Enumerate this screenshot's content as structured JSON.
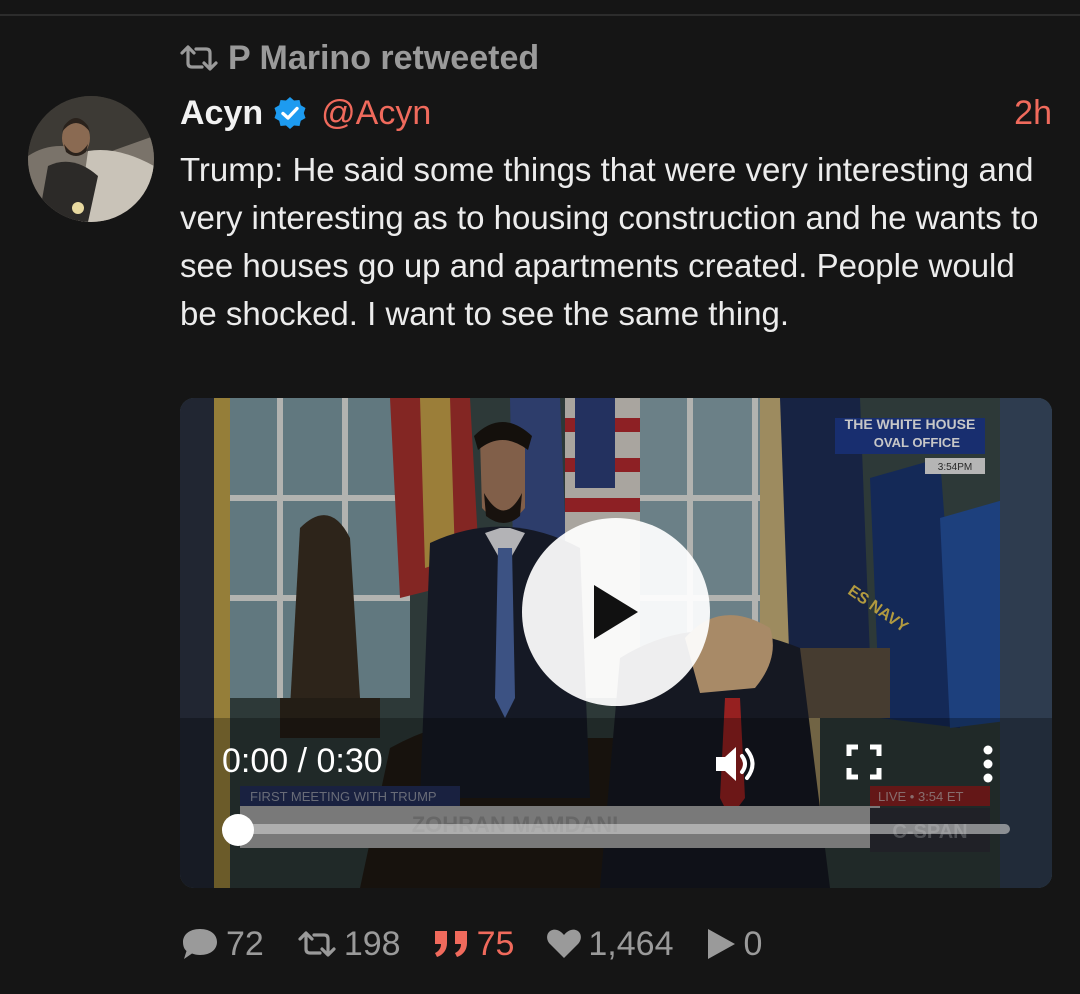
{
  "retweet": {
    "label": "P Marino retweeted"
  },
  "tweet": {
    "name": "Acyn",
    "handle": "@Acyn",
    "time": "2h",
    "text": "Trump: He said some things that were very interesting and very interesting as to housing construction and he wants to see houses go up and apartments created. People would be shocked. I want to see the same thing."
  },
  "video": {
    "timecode": "0:00 / 0:30",
    "progress_fraction": 0.0,
    "overlay_top": [
      "THE WHITE HOUSE",
      "OVAL OFFICE",
      "3:54PM"
    ],
    "overlay_bottom": [
      "FIRST MEETING WITH TRUMP",
      "ZOHRAN MAMDANI",
      "LIVE • 3:54 ET",
      "C-SPAN"
    ],
    "flag_text": "ES NAVY"
  },
  "stats": {
    "replies": "72",
    "retweets": "198",
    "quotes": "75",
    "likes": "1,464",
    "views": "0"
  },
  "colors": {
    "background": "#151515",
    "accent": "#f06a5c",
    "verified": "#1d9bf0",
    "muted": "#9a9a9a"
  }
}
